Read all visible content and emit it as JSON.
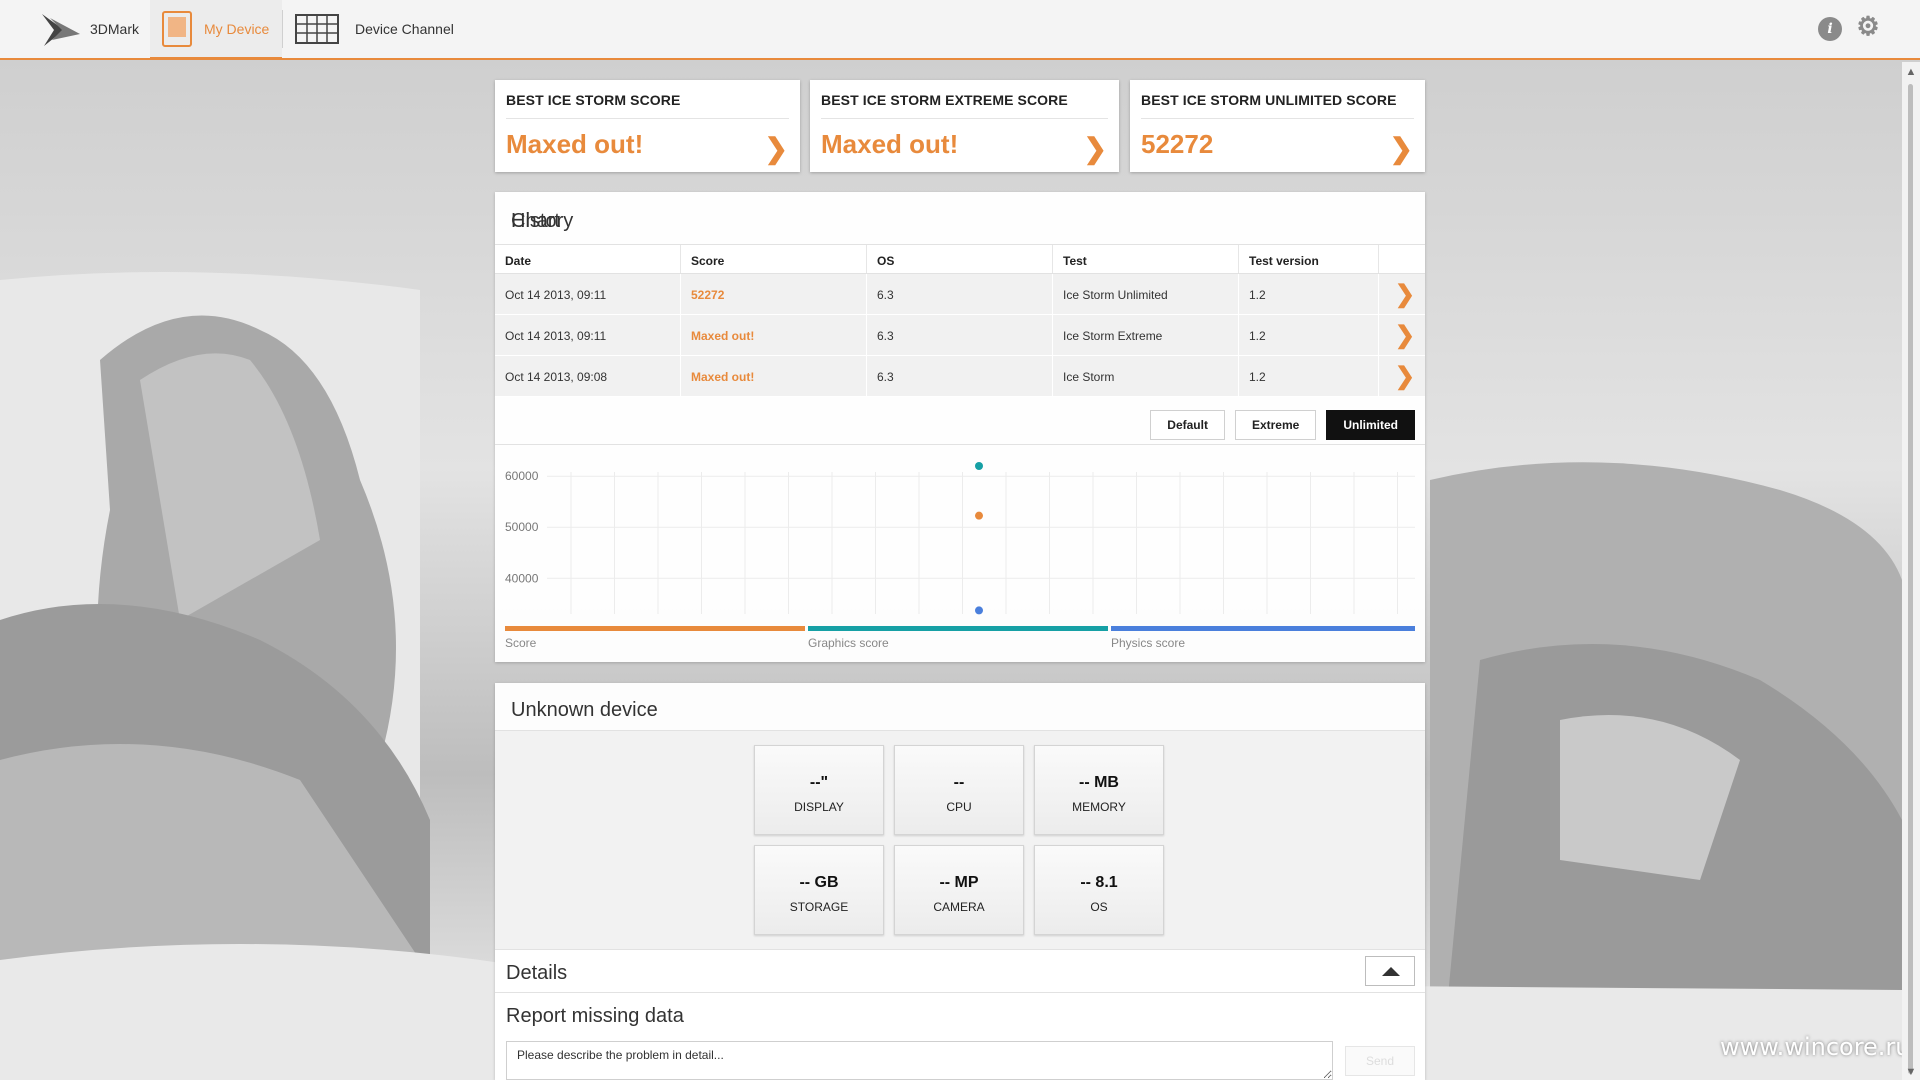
{
  "topbar": {
    "logo_label": "3DMark",
    "my_device_label": "My Device",
    "device_channel_label": "Device Channel",
    "info_icon": "info-icon",
    "settings_icon": "gear-icon"
  },
  "cards": [
    {
      "title": "BEST ICE STORM SCORE",
      "value": "Maxed out!"
    },
    {
      "title": "BEST ICE STORM EXTREME SCORE",
      "value": "Maxed out!"
    },
    {
      "title": "BEST ICE STORM UNLIMITED SCORE",
      "value": "52272"
    }
  ],
  "history": {
    "title": "History",
    "columns": [
      "Date",
      "Score",
      "OS",
      "Test",
      "Test version"
    ],
    "rows": [
      {
        "date": "Oct 14 2013, 09:11",
        "score": "52272",
        "os": "6.3",
        "test": "Ice Storm Unlimited",
        "version": "1.2"
      },
      {
        "date": "Oct 14 2013, 09:11",
        "score": "Maxed out!",
        "os": "6.3",
        "test": "Ice Storm Extreme",
        "version": "1.2"
      },
      {
        "date": "Oct 14 2013, 09:08",
        "score": "Maxed out!",
        "os": "6.3",
        "test": "Ice Storm",
        "version": "1.2"
      }
    ]
  },
  "chart": {
    "title": "Chart",
    "buttons": {
      "default": "Default",
      "extreme": "Extreme",
      "unlimited": "Unlimited"
    },
    "active_button": "Unlimited"
  },
  "chart_data": {
    "type": "scatter",
    "title": "",
    "xlabel": "",
    "ylabel": "",
    "y_ticks": [
      "60000",
      "50000",
      "40000"
    ],
    "ylim": [
      33000,
      62000
    ],
    "grid": true,
    "legend_placement": "bottom",
    "series": [
      {
        "name": "Score",
        "color": "#e88a3c",
        "values": [
          52272
        ]
      },
      {
        "name": "Graphics score",
        "color": "#16a0a5",
        "values": [
          62000
        ]
      },
      {
        "name": "Physics score",
        "color": "#4a7fdc",
        "values": [
          33700
        ]
      }
    ]
  },
  "device": {
    "title": "Unknown device",
    "tiles": [
      {
        "value": "--\"",
        "label": "DISPLAY"
      },
      {
        "value": "--",
        "label": "CPU"
      },
      {
        "value": "-- MB",
        "label": "MEMORY"
      },
      {
        "value": "-- GB",
        "label": "STORAGE"
      },
      {
        "value": "-- MP",
        "label": "CAMERA"
      },
      {
        "value": "-- 8.1",
        "label": "OS"
      }
    ],
    "details_title": "Details",
    "report_title": "Report missing data",
    "report_placeholder": "Please describe the problem in detail...",
    "send_label": "Send"
  },
  "watermark": "www.wincore.ru"
}
